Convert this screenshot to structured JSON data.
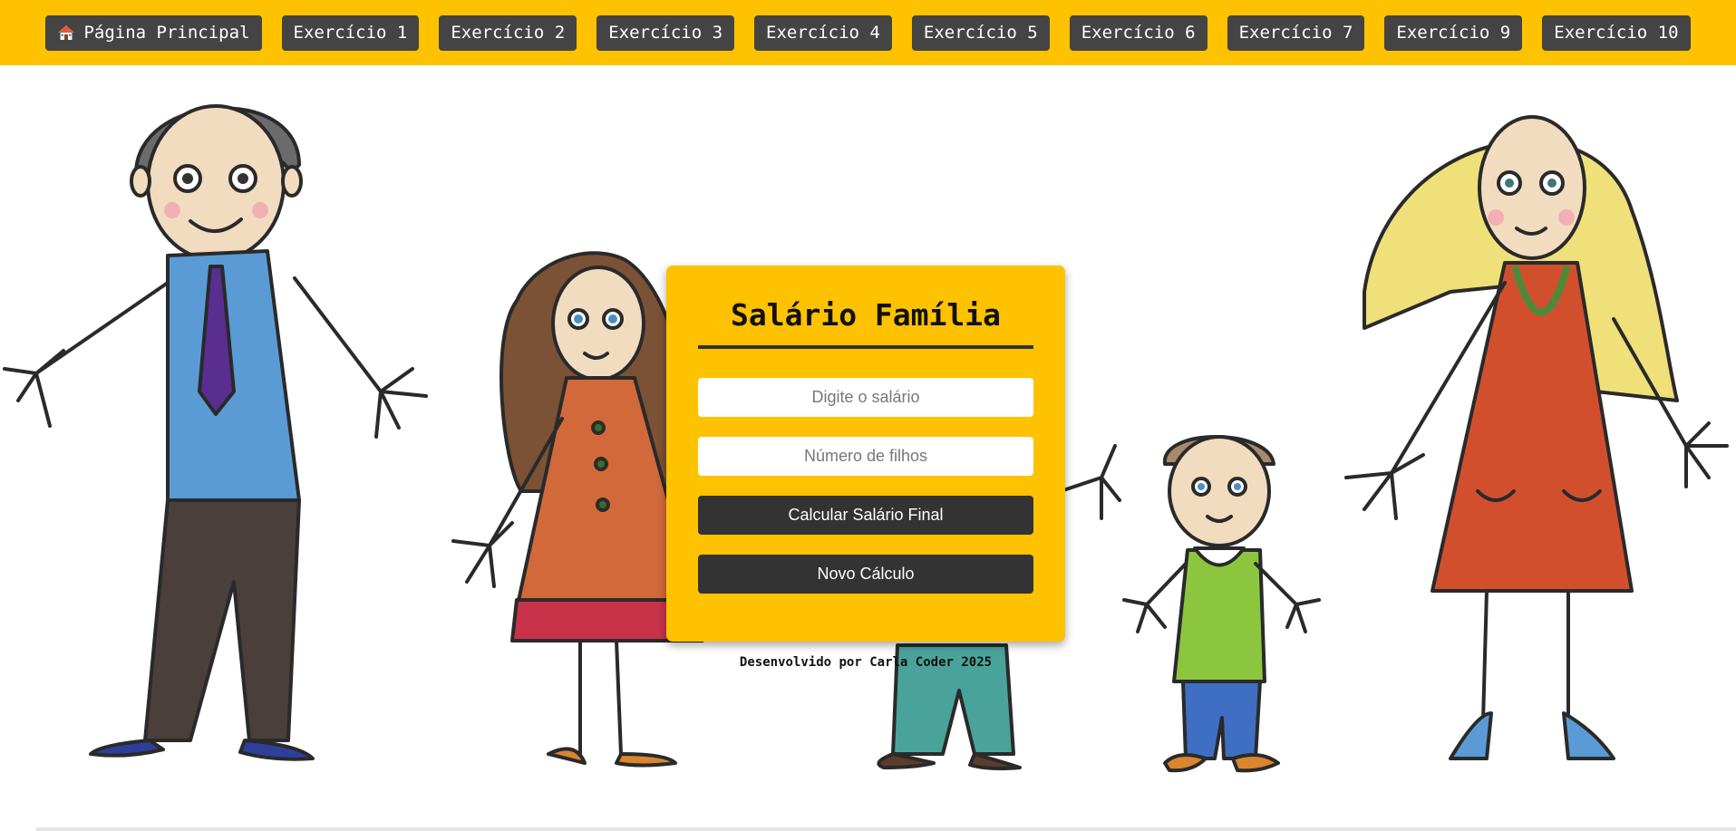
{
  "nav": {
    "items": [
      {
        "label": "Página Principal",
        "icon": "house-icon"
      },
      {
        "label": "Exercício 1"
      },
      {
        "label": "Exercício 2"
      },
      {
        "label": "Exercício 3"
      },
      {
        "label": "Exercício 4"
      },
      {
        "label": "Exercício 5"
      },
      {
        "label": "Exercício 6"
      },
      {
        "label": "Exercício 7"
      },
      {
        "label": "Exercício 9"
      },
      {
        "label": "Exercício 10"
      }
    ]
  },
  "card": {
    "title": "Salário Família",
    "salary_placeholder": "Digite o salário",
    "children_placeholder": "Número de filhos",
    "calculate_label": "Calcular Salário Final",
    "reset_label": "Novo Cálculo"
  },
  "footer": {
    "text": "Desenvolvido por Carla Coder 2025"
  },
  "colors": {
    "accent": "#fec200",
    "button_dark": "#444444",
    "card_button": "#333333"
  }
}
